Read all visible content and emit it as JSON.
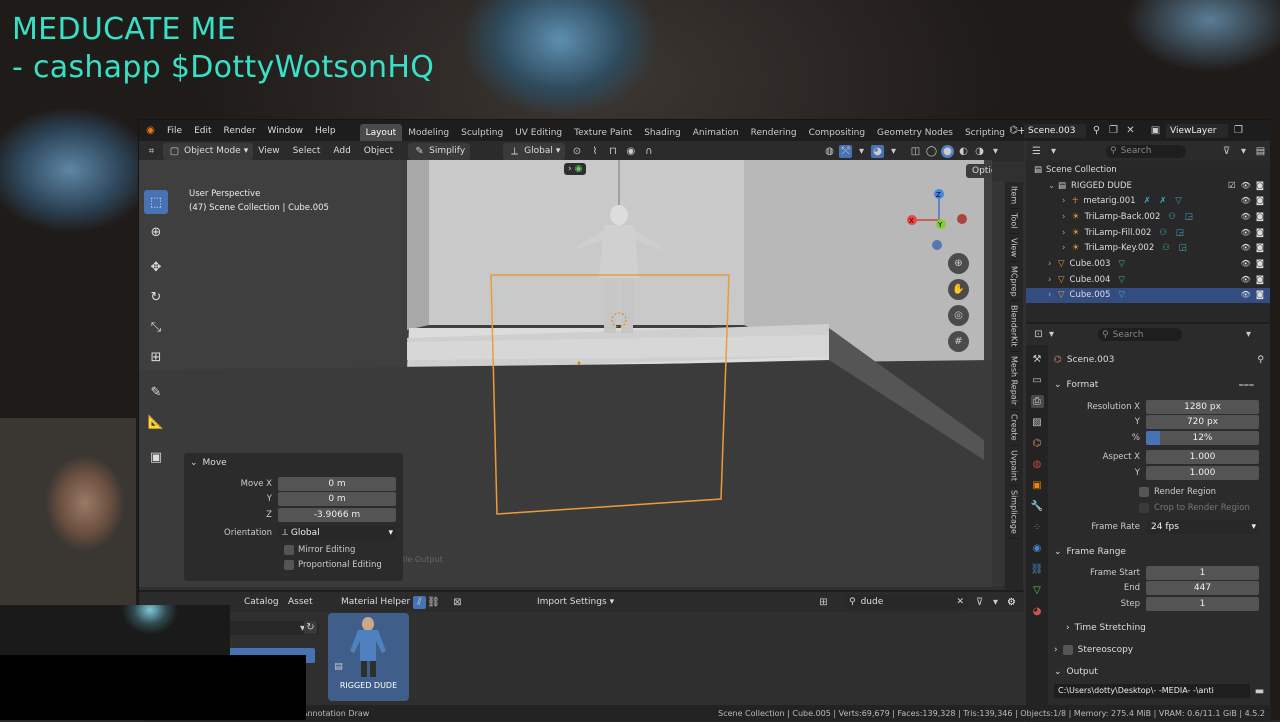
{
  "overlay": {
    "line1": "MEDUCATE ME",
    "line2": "- cashapp $DottyWotsonHQ"
  },
  "menu": {
    "items": [
      "File",
      "Edit",
      "Render",
      "Window",
      "Help"
    ]
  },
  "workspaces": [
    "Layout",
    "Modeling",
    "Sculpting",
    "UV Editing",
    "Texture Paint",
    "Shading",
    "Animation",
    "Rendering",
    "Compositing",
    "Geometry Nodes",
    "Scripting"
  ],
  "workspace_active": "Layout",
  "add_workspace": "+",
  "scene": {
    "name": "Scene.003",
    "view_layer": "ViewLayer"
  },
  "header": {
    "mode": "Object Mode",
    "view": "View",
    "select": "Select",
    "add": "Add",
    "object": "Object",
    "simplify": "Simplify",
    "orientation": "Global",
    "options": "Options"
  },
  "viewport": {
    "perspective": "User Perspective",
    "context": "(47) Scene Collection | Cube.005",
    "gizmo_x": "X",
    "gizmo_y": "Y",
    "gizmo_z": "Z"
  },
  "side_tabs": [
    "Item",
    "Tool",
    "View",
    "MCprep",
    "BlenderKit",
    "Mesh Repair",
    "Create",
    "Uvpaint",
    "Simplicage"
  ],
  "redo_panel": {
    "title": "Move",
    "move_x_label": "Move X",
    "move_x": "0 m",
    "y_label": "Y",
    "y": "0 m",
    "z_label": "Z",
    "z": "-3.9066 m",
    "orientation_label": "Orientation",
    "orientation": "Global",
    "mirror": "Mirror Editing",
    "proportional": "Proportional Editing"
  },
  "faded_text": "ile Output",
  "asset_browser": {
    "catalog": "Catalog",
    "asset": "Asset",
    "material_helper": "Material Helper",
    "import_settings": "Import Settings",
    "search": "dude",
    "item_label": "RIGGED DUDE"
  },
  "status": {
    "left": "Annotation Draw",
    "right": "Scene Collection | Cube.005 | Verts:69,679 | Faces:139,328 | Tris:139,346 | Objects:1/8 | Memory: 275.4 MiB | VRAM: 0.6/11.1 GiB | 4.5.2"
  },
  "outliner": {
    "search_placeholder": "Search",
    "root": "Scene Collection",
    "items": [
      {
        "name": "RIGGED DUDE",
        "indent": 1,
        "type": "collection"
      },
      {
        "name": "metarig.001",
        "indent": 2,
        "type": "armature"
      },
      {
        "name": "TriLamp-Back.002",
        "indent": 2,
        "type": "light"
      },
      {
        "name": "TriLamp-Fill.002",
        "indent": 2,
        "type": "light"
      },
      {
        "name": "TriLamp-Key.002",
        "indent": 2,
        "type": "light"
      },
      {
        "name": "Cube.003",
        "indent": 1,
        "type": "mesh"
      },
      {
        "name": "Cube.004",
        "indent": 1,
        "type": "mesh"
      },
      {
        "name": "Cube.005",
        "indent": 1,
        "type": "mesh",
        "selected": true
      }
    ]
  },
  "properties": {
    "search_placeholder": "Search",
    "scene": "Scene.003",
    "format": "Format",
    "res_x_label": "Resolution X",
    "res_x": "1280 px",
    "res_y_label": "Y",
    "res_y": "720 px",
    "pct_label": "%",
    "pct": "12%",
    "pct_value": 0.12,
    "aspect_x_label": "Aspect X",
    "aspect_x": "1.000",
    "aspect_y_label": "Y",
    "aspect_y": "1.000",
    "render_region": "Render Region",
    "crop": "Crop to Render Region",
    "frame_rate_label": "Frame Rate",
    "frame_rate": "24 fps",
    "frame_range": "Frame Range",
    "fs_label": "Frame Start",
    "fs": "1",
    "end_label": "End",
    "end": "447",
    "step_label": "Step",
    "step": "1",
    "time_stretching": "Time Stretching",
    "stereoscopy": "Stereoscopy",
    "output": "Output",
    "path": "C:\\Users\\dotty\\Desktop\\- -MEDIA- -\\anti"
  }
}
